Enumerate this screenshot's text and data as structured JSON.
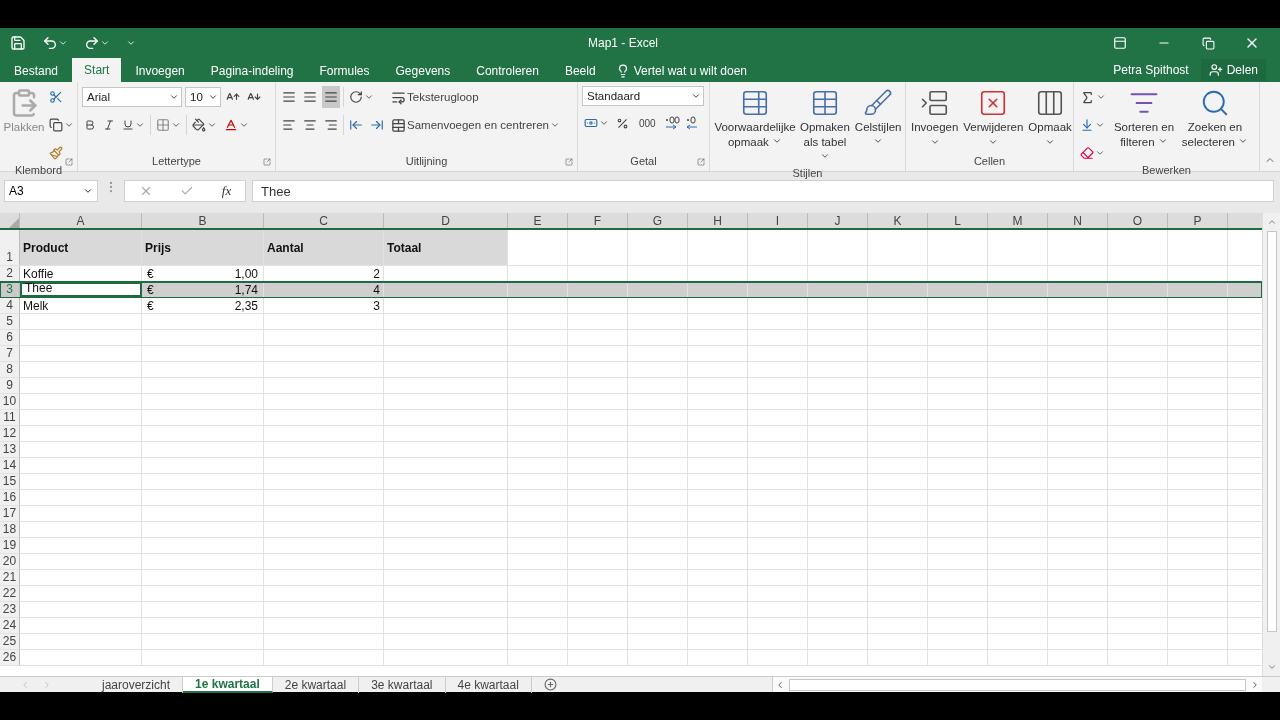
{
  "window": {
    "title": "Map1 - Excel"
  },
  "ribbon_tabs": [
    {
      "label": "Bestand",
      "selected": false
    },
    {
      "label": "Start",
      "selected": true
    },
    {
      "label": "Invoegen",
      "selected": false
    },
    {
      "label": "Pagina-indeling",
      "selected": false
    },
    {
      "label": "Formules",
      "selected": false
    },
    {
      "label": "Gegevens",
      "selected": false
    },
    {
      "label": "Controleren",
      "selected": false
    },
    {
      "label": "Beeld",
      "selected": false
    }
  ],
  "tell_me": "Vertel wat u wilt doen",
  "user": "Petra Spithost",
  "share": "Delen",
  "ribbon": {
    "clipboard": {
      "paste": "Plakken",
      "label": "Klembord"
    },
    "font": {
      "name": "Arial",
      "size": "10",
      "label": "Lettertype"
    },
    "alignment": {
      "wrap": "Teksterugloop",
      "merge": "Samenvoegen en centreren",
      "label": "Uitlijning"
    },
    "number": {
      "format": "Standaard",
      "thousands": "000",
      "label": "Getal"
    },
    "styles": {
      "buttons": [
        "Voorwaardelijke opmaak",
        "Opmaken als tabel",
        "Celstijlen"
      ],
      "label": "Stijlen"
    },
    "cells": {
      "buttons": [
        "Invoegen",
        "Verwijderen",
        "Opmaak"
      ],
      "label": "Cellen"
    },
    "editing": {
      "buttons": [
        "Sorteren en filteren",
        "Zoeken en selecteren"
      ],
      "label": "Bewerken"
    }
  },
  "formula_bar": {
    "name_box": "A3",
    "function_label": "fx",
    "value": "Thee"
  },
  "columns": [
    "A",
    "B",
    "C",
    "D",
    "E",
    "F",
    "G",
    "H",
    "I",
    "J",
    "K",
    "L",
    "M",
    "N",
    "O",
    "P"
  ],
  "rows": [
    {
      "label": "1",
      "header": true,
      "selected": false,
      "cells": [
        {
          "kind": "text",
          "text": "Product"
        },
        {
          "kind": "text",
          "text": "Prijs"
        },
        {
          "kind": "text",
          "text": "Aantal"
        },
        {
          "kind": "text",
          "text": "Totaal"
        }
      ]
    },
    {
      "label": "2",
      "header": false,
      "selected": false,
      "cells": [
        {
          "kind": "text",
          "text": "Koffie"
        },
        {
          "kind": "currency",
          "symbol": "€",
          "text": "1,00"
        },
        {
          "kind": "number",
          "text": "2"
        }
      ]
    },
    {
      "label": "3",
      "header": false,
      "selected": true,
      "cells": [
        {
          "kind": "text",
          "text": "Thee",
          "active": true
        },
        {
          "kind": "currency",
          "symbol": "€",
          "text": "1,74"
        },
        {
          "kind": "number",
          "text": "4"
        }
      ]
    },
    {
      "label": "4",
      "header": false,
      "selected": false,
      "cells": [
        {
          "kind": "text",
          "text": "Melk"
        },
        {
          "kind": "currency",
          "symbol": "€",
          "text": "2,35"
        },
        {
          "kind": "number",
          "text": "3"
        }
      ]
    },
    {
      "label": "5"
    },
    {
      "label": "6"
    },
    {
      "label": "7"
    },
    {
      "label": "8"
    },
    {
      "label": "9"
    },
    {
      "label": "10"
    },
    {
      "label": "11"
    },
    {
      "label": "12"
    },
    {
      "label": "13"
    },
    {
      "label": "14"
    },
    {
      "label": "15"
    },
    {
      "label": "16"
    },
    {
      "label": "17"
    },
    {
      "label": "18"
    },
    {
      "label": "19"
    },
    {
      "label": "20"
    },
    {
      "label": "21"
    },
    {
      "label": "22"
    },
    {
      "label": "23"
    },
    {
      "label": "24"
    },
    {
      "label": "25"
    },
    {
      "label": "26"
    }
  ],
  "sheet_tabs": [
    {
      "label": "jaaroverzicht",
      "selected": false
    },
    {
      "label": "1e kwartaal",
      "selected": true
    },
    {
      "label": "2e kwartaal",
      "selected": false
    },
    {
      "label": "3e kwartaal",
      "selected": false
    },
    {
      "label": "4e kwartaal",
      "selected": false
    }
  ]
}
